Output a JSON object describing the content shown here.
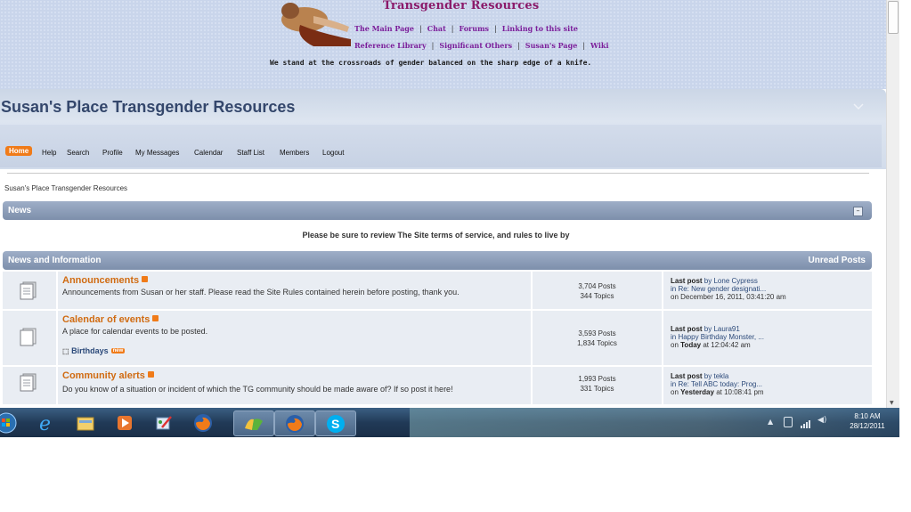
{
  "banner": {
    "title": "Transgender Resources",
    "nav_row1": [
      "The Main Page",
      "Chat",
      "Forums",
      "Linking to this site"
    ],
    "nav_row2": [
      "Reference Library",
      "Significant Others",
      "Susan's Page",
      "Wiki"
    ],
    "motto": "We stand at the crossroads of gender balanced on the sharp edge of a knife."
  },
  "forum": {
    "title": "Susan's Place Transgender Resources",
    "menu": [
      "Home",
      "Help",
      "Search",
      "Profile",
      "My Messages",
      "Calendar",
      "Staff List",
      "Members",
      "Logout"
    ],
    "breadcrumb": "Susan's Place Transgender Resources"
  },
  "news": {
    "header": "News",
    "notice": "Please be sure to review The Site terms of service, and rules to live by"
  },
  "category": {
    "header": "News and Information",
    "unread": "Unread Posts"
  },
  "boards": [
    {
      "name": "Announcements",
      "description": "Announcements from Susan or her staff. Please read the Site Rules contained herein before posting, thank you.",
      "posts": "3,704 Posts",
      "topics": "344 Topics",
      "last_label": "Last post",
      "last_by": "by Lone Cypress",
      "last_in": "in Re: New gender designati...",
      "last_on": "on December 16, 2011, 03:41:20 am"
    },
    {
      "name": "Calendar of events",
      "description": "A place for calendar events to be posted.",
      "child": "Birthdays",
      "child_badge": "new",
      "posts": "3,593 Posts",
      "topics": "1,834 Topics",
      "last_label": "Last post",
      "last_by": "by Laura91",
      "last_in": "in Happy Birthday Monster, ...",
      "last_on_prefix": "on",
      "last_on_strong": "Today",
      "last_on_rest": "at 12:04:42 am"
    },
    {
      "name": "Community alerts",
      "description": "Do you know of a situation or incident of which the TG community should be made aware of? If so post it here!",
      "posts": "1,993 Posts",
      "topics": "331 Topics",
      "last_label": "Last post",
      "last_by": "by tekla",
      "last_in": "in Re: Tell ABC today: Prog...",
      "last_on_prefix": "on",
      "last_on_strong": "Yesterday",
      "last_on_rest": "at 10:08:41 pm"
    }
  ],
  "taskbar": {
    "time": "8:10 AM",
    "date": "28/12/2011",
    "apps": [
      "start-orb-icon",
      "internet-explorer-icon",
      "file-explorer-icon",
      "media-player-icon",
      "paint-icon",
      "firefox-icon",
      "windows-live-icon",
      "firefox-active-icon",
      "skype-icon"
    ]
  },
  "colors": {
    "accent": "#f07b19",
    "title": "#34476c",
    "board_name": "#d06b12",
    "category_bar": "#8797b3"
  }
}
